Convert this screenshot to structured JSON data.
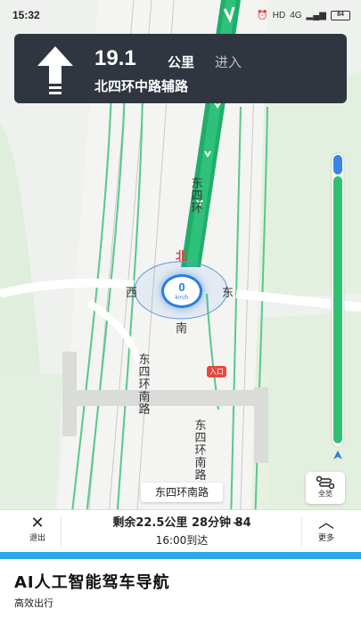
{
  "status_bar": {
    "time": "15:32",
    "icons": [
      "alarm-icon",
      "hd-icon",
      "signal-4g-icon",
      "signal-icon"
    ],
    "network": "4G",
    "battery": "84"
  },
  "guidance": {
    "distance": "19.1",
    "unit": "公里",
    "action": "进入",
    "road": "北四环中路辅路",
    "maneuver_icon": "straight-arrow-icon"
  },
  "compass": {
    "north": "北",
    "west": "西",
    "east": "东",
    "south": "南",
    "speed": "0",
    "speed_unit": "km/h"
  },
  "map_labels": {
    "road_1": "东四环",
    "road_2": "东四环南路",
    "road_3": "东四环南路",
    "entrance": "入口"
  },
  "current_road": "东四环南路",
  "overview": {
    "label": "全览",
    "icon": "route-overview-icon"
  },
  "bottom_bar": {
    "exit_label": "退出",
    "remain": "剩余22.5公里 28分钟 8̶4",
    "arrive": "16:00到达",
    "more_label": "更多"
  },
  "promo": {
    "title": "AI人工智能驾车导航",
    "subtitle": "高效出行"
  },
  "colors": {
    "route": "#1fae6a",
    "card": "#2f3640",
    "accent": "#2a7de1",
    "bottom_accent": "#2aa7e8"
  }
}
